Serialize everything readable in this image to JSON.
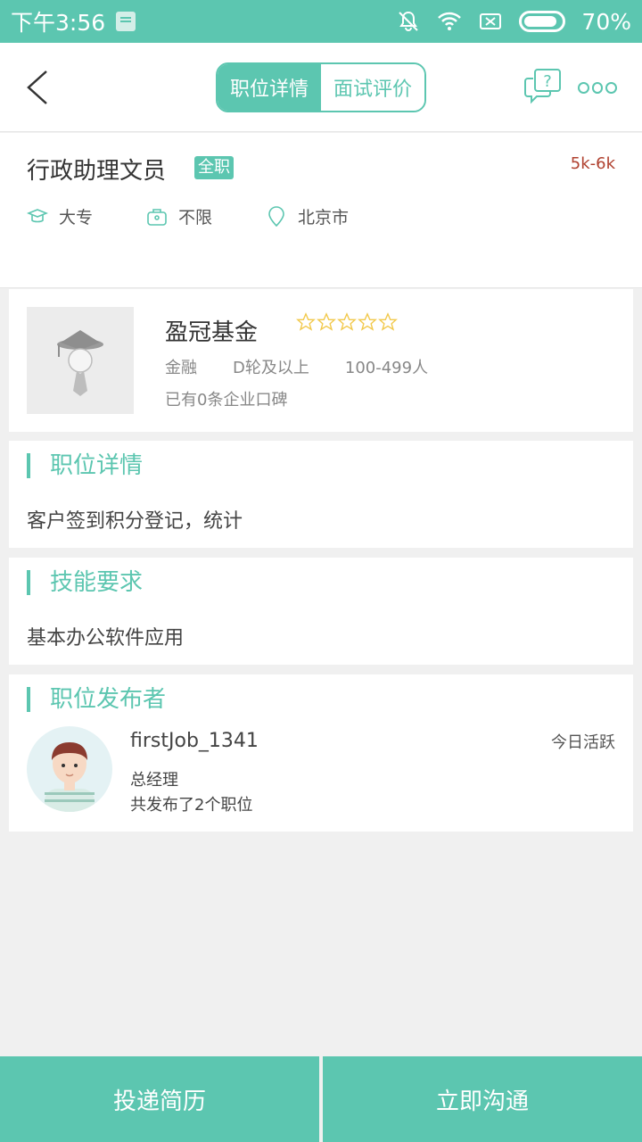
{
  "status_bar": {
    "time": "下午3:56",
    "battery": "70%"
  },
  "nav": {
    "tabs": [
      {
        "label": "职位详情",
        "active": true
      },
      {
        "label": "面试评价",
        "active": false
      }
    ],
    "help_icon": "chat-question-icon",
    "more_icon": "more-dots-icon"
  },
  "job": {
    "title": "行政助理文员",
    "type": "全职",
    "salary": "5k-6k",
    "education": "大专",
    "experience": "不限",
    "location": "北京市"
  },
  "company": {
    "name": "盈冠基金",
    "stars": 0,
    "industry": "金融",
    "funding": "D轮及以上",
    "size": "100-499人",
    "reviews": "已有0条企业口碑"
  },
  "sections": {
    "detail_title": "职位详情",
    "detail_body": "客户签到积分登记，统计",
    "skills_title": "技能要求",
    "skills_body": "基本办公软件应用",
    "publisher_title": "职位发布者"
  },
  "publisher": {
    "name": "firstJob_1341",
    "role": "总经理",
    "count": "共发布了2个职位",
    "active": "今日活跃"
  },
  "actions": {
    "apply": "投递简历",
    "chat": "立即沟通"
  },
  "colors": {
    "accent": "#5cc6b0",
    "salary": "#b0412f",
    "star": "#f2c94c"
  }
}
